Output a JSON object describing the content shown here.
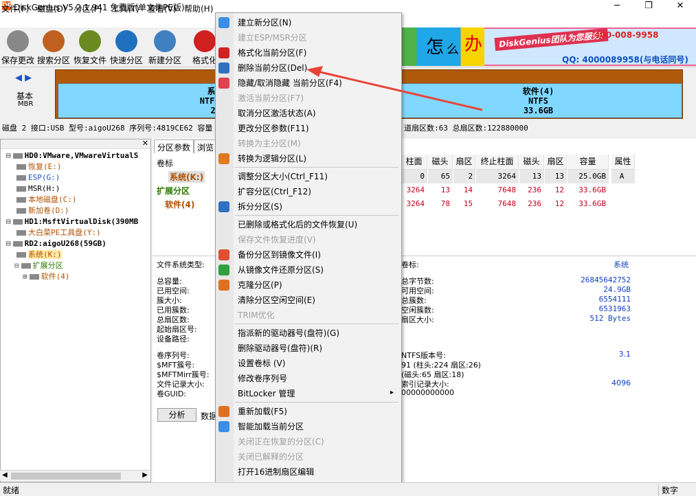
{
  "window": {
    "title": "DiskGenius V5.2.1.941 免费版(单文件PE版)",
    "app_icon": "DG"
  },
  "menubar": [
    "文件(F)",
    "磁盘(D)",
    "分区(P)",
    "工具(T)",
    "查看(V)",
    "帮助(H)"
  ],
  "toolbar": [
    {
      "label": "保存更改",
      "icon": "save-icon",
      "color": "#888888"
    },
    {
      "label": "搜索分区",
      "icon": "search-icon",
      "color": "#c06020"
    },
    {
      "label": "恢复文件",
      "icon": "recover-icon",
      "color": "#6a8a20"
    },
    {
      "label": "快速分区",
      "icon": "quick-partition-icon",
      "color": "#2070c0"
    },
    {
      "label": "新建分区",
      "icon": "new-partition-icon",
      "color": "#4080c0"
    },
    {
      "label": "格式化",
      "icon": "format-icon",
      "color": "#d02020"
    }
  ],
  "banner": {
    "slogan": "DiskGenius团队为您服务!",
    "phone": "400-008-9958",
    "qq": "QQ: 4000089958(与电话同号)",
    "chars": [
      "怎",
      "么",
      "办"
    ]
  },
  "diskmap": {
    "nav_left": "◀",
    "nav_right": "▶",
    "disk_type": "基本",
    "disk_style": "MBR",
    "partitions": [
      {
        "name": "系统(K:)",
        "fs": "NTFS (活动)",
        "size": "25.0GB"
      },
      {
        "name": "软件(4)",
        "fs": "NTFS",
        "size": "33.6GB"
      }
    ]
  },
  "disk_info": "磁盘 2 接口:USB  型号:aigoU268  序列号:4819CE62  容量",
  "disk_info_right": "道扇区数:63  总扇区数:122880000",
  "tree": [
    {
      "text": "HD0:VMware,VMwareVirtualS",
      "color": "#000"
    },
    {
      "text": "恢复(E:)",
      "color": "#b05000"
    },
    {
      "text": "ESP(G:)",
      "color": "#2050c0"
    },
    {
      "text": "MSR(H:)",
      "color": "#000"
    },
    {
      "text": "本地磁盘(C:)",
      "color": "#b05000"
    },
    {
      "text": "新加卷(D:)",
      "color": "#b05000"
    },
    {
      "text": "HD1:MsftVirtualDisk(390MB",
      "color": "#000"
    },
    {
      "text": "大白菜PE工具盘(Y:)",
      "color": "#b05000"
    },
    {
      "text": "RD2:aigoU268(59GB)",
      "color": "#000"
    },
    {
      "text": "系统(K:)",
      "color": "#b05000"
    },
    {
      "text": "扩展分区",
      "color": "#2a7a00"
    },
    {
      "text": "软件(4)",
      "color": "#b05000"
    }
  ],
  "tabs": [
    "分区参数",
    "浏览"
  ],
  "grid": {
    "header_left": "卷标",
    "headers": [
      "柱面",
      "磁头",
      "扇区",
      "终止柱面",
      "磁头",
      "扇区",
      "容量",
      "属性"
    ],
    "rows": [
      {
        "label": "系统(K:)",
        "cells": [
          "0",
          "65",
          "2",
          "3264",
          "13",
          "13",
          "25.0GB",
          "A"
        ]
      },
      {
        "label": "扩展分区",
        "cells": [
          "3264",
          "13",
          "14",
          "7648",
          "236",
          "12",
          "33.6GB",
          ""
        ]
      },
      {
        "label": "软件(4)",
        "cells": [
          "3264",
          "78",
          "15",
          "7648",
          "236",
          "12",
          "33.6GB",
          ""
        ]
      }
    ]
  },
  "lower": {
    "fs_type_label": "文件系统类型:",
    "volume_label": "卷标:",
    "volume_value": "系统",
    "left_labels": [
      "总容量:",
      "已用空间:",
      "簇大小:",
      "已用簇数:",
      "总扇区数:",
      "起始扇区号:",
      "设备路径:"
    ],
    "right_labels": [
      "总字节数:",
      "可用空间:",
      "总簇数:",
      "空闲簇数:",
      "扇区大小:"
    ],
    "right_values": [
      "26845642752",
      "24.9GB",
      "6554111",
      "6531963",
      "512 Bytes"
    ],
    "left2_labels": [
      "卷序列号:",
      "$MFT簇号:",
      "$MFTMirr簇号:",
      "文件记录大小:",
      "卷GUID:"
    ],
    "right2": [
      "NTFS版本号:",
      "91 (柱头:224 扇区:26)",
      "(磁头:65 扇区:18)",
      "索引记录大小:",
      "00000000000"
    ],
    "right2_values": [
      "3.1",
      "",
      "",
      "4096",
      ""
    ],
    "analyze_button": "分析",
    "data_label": "数据"
  },
  "context_menu": [
    {
      "label": "建立新分区(N)",
      "enabled": true,
      "icon": "new-partition-icon",
      "color": "#3a8ee6"
    },
    {
      "label": "建立ESP/MSR分区",
      "enabled": false
    },
    {
      "label": "格式化当前分区(F)",
      "enabled": true,
      "icon": "format-icon",
      "color": "#d02020"
    },
    {
      "label": "删除当前分区(Del)",
      "enabled": true,
      "icon": "delete-icon",
      "color": "#3070c0"
    },
    {
      "label": "隐藏/取消隐藏 当前分区(F4)",
      "enabled": true,
      "icon": "hide-icon",
      "color": "#e04050"
    },
    {
      "label": "激活当前分区(F7)",
      "enabled": false
    },
    {
      "label": "取消分区激活状态(A)",
      "enabled": true
    },
    {
      "label": "更改分区参数(F11)",
      "enabled": true
    },
    {
      "label": "转换为主分区(M)",
      "enabled": false
    },
    {
      "label": "转换为逻辑分区(L)",
      "enabled": true,
      "icon": "logical-icon",
      "color": "#e07a20"
    },
    "sep",
    {
      "label": "调整分区大小(Ctrl_F11)",
      "enabled": true
    },
    {
      "label": "扩容分区(Ctrl_F12)",
      "enabled": true
    },
    {
      "label": "拆分分区(S)",
      "enabled": true,
      "icon": "split-icon",
      "color": "#3070c0"
    },
    "sep",
    {
      "label": "已删除或格式化后的文件恢复(U)",
      "enabled": true
    },
    {
      "label": "保存文件恢复进度(V)",
      "enabled": false
    },
    {
      "label": "备份分区到镜像文件(I)",
      "enabled": true,
      "icon": "backup-icon",
      "color": "#e05030"
    },
    {
      "label": "从镜像文件还原分区(S)",
      "enabled": true,
      "icon": "restore-icon",
      "color": "#30a040"
    },
    {
      "label": "克隆分区(P)",
      "enabled": true,
      "icon": "clone-icon",
      "color": "#e07020"
    },
    {
      "label": "清除分区空闲空间(E)",
      "enabled": true
    },
    {
      "label": "TRIM优化",
      "enabled": false
    },
    "sep",
    {
      "label": "指派新的驱动器号(盘符)(G)",
      "enabled": true
    },
    {
      "label": "删除驱动器号(盘符)(R)",
      "enabled": true
    },
    {
      "label": "设置卷标 (V)",
      "enabled": true
    },
    {
      "label": "修改卷序列号",
      "enabled": true
    },
    {
      "label": "BitLocker 管理",
      "enabled": true,
      "submenu": "▸"
    },
    "sep",
    {
      "label": "重新加载(F5)",
      "enabled": true,
      "icon": "reload-icon",
      "color": "#e07020"
    },
    {
      "label": "智能加载当前分区",
      "enabled": true,
      "icon": "smart-load-icon",
      "color": "#3a8ee6"
    },
    {
      "label": "关闭正在恢复的分区(C)",
      "enabled": false
    },
    {
      "label": "关闭已解释的分区",
      "enabled": false
    },
    {
      "label": "打开16进制扇区编辑",
      "enabled": true
    }
  ],
  "statusbar": {
    "left": "就绪",
    "right": "数字"
  }
}
